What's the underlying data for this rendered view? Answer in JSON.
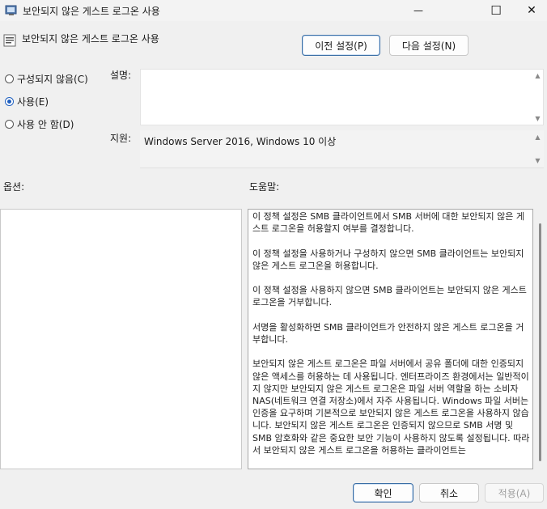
{
  "window": {
    "title": "보안되지 않은 게스트 로그온 사용",
    "controls": {
      "minimize": "—",
      "maximize": "☐",
      "close": "✕"
    }
  },
  "header": {
    "policy_name": "보안되지 않은 게스트 로그온 사용",
    "prev_button": "이전 설정(P)",
    "next_button": "다음 설정(N)"
  },
  "options": [
    {
      "label": "구성되지 않음(C)",
      "checked": false
    },
    {
      "label": "사용(E)",
      "checked": true
    },
    {
      "label": "사용 안 함(D)",
      "checked": false
    }
  ],
  "fields": {
    "comment_label": "설명:",
    "comment_value": "",
    "supported_label": "지원:",
    "supported_value": "Windows Server 2016, Windows 10 이상"
  },
  "sections": {
    "options_label": "옵션:",
    "help_label": "도움말:"
  },
  "help": {
    "paragraphs": [
      "이 정책 설정은 SMB 클라이언트에서 SMB 서버에 대한 보안되지 않은 게스트 로그온을 허용할지 여부를 결정합니다.",
      "이 정책 설정을 사용하거나 구성하지 않으면 SMB 클라이언트는 보안되지 않은 게스트 로그온을 허용합니다.",
      "이 정책 설정을 사용하지 않으면 SMB 클라이언트는 보안되지 않은 게스트 로그온을 거부합니다.",
      "서명을 활성화하면 SMB 클라이언트가 안전하지 않은 게스트 로그온을 거부합니다.",
      "보안되지 않은 게스트 로그온은 파일 서버에서 공유 폴더에 대한 인증되지 않은 액세스를 허용하는 데 사용됩니다. 엔터프라이즈 환경에서는 일반적이지 않지만 보안되지 않은 게스트 로그온은 파일 서버 역할을 하는 소비자 NAS(네트워크 연결 저장소)에서 자주 사용됩니다. Windows 파일 서버는 인증을 요구하며 기본적으로 보안되지 않은 게스트 로그온을 사용하지 않습니다. 보안되지 않은 게스트 로그온은 인증되지 않으므로 SMB 서명 및 SMB 암호화와 같은 중요한 보안 기능이 사용하지 않도록 설정됩니다. 따라서 보안되지 않은 게스트 로그온을 허용하는 클라이언트는"
    ]
  },
  "footer": {
    "ok": "확인",
    "cancel": "취소",
    "apply": "적용(A)"
  }
}
